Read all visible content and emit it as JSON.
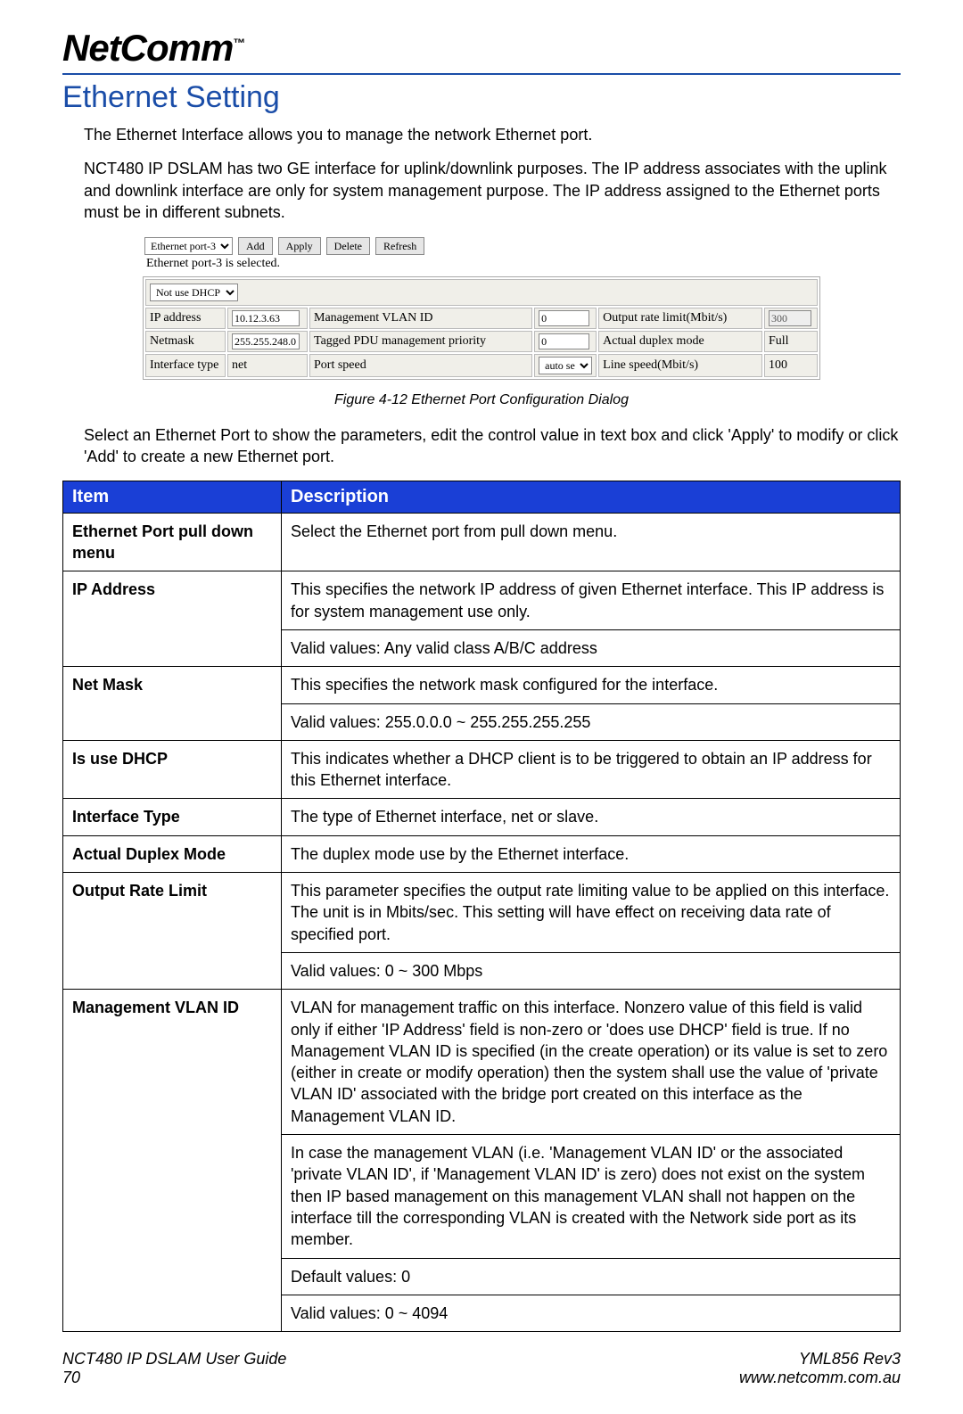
{
  "brand": {
    "name": "NetComm",
    "tm": "™"
  },
  "title": "Ethernet Setting",
  "paras": {
    "intro": "The Ethernet Interface allows you to manage the network Ethernet port.",
    "detail": "NCT480 IP DSLAM has two GE interface for uplink/downlink purposes. The IP address associates with the uplink and downlink interface are only for system management purpose. The IP address assigned to the Ethernet ports must be in different subnets.",
    "usage": "Select an Ethernet Port to show the parameters, edit the control value in text box and click 'Apply' to modify or click 'Add' to create a new Ethernet port."
  },
  "dialog": {
    "port_select": "Ethernet port-3",
    "buttons": {
      "add": "Add",
      "apply": "Apply",
      "delete": "Delete",
      "refresh": "Refresh"
    },
    "status": "Ethernet port-3 is selected.",
    "dhcp_select": "Not use DHCP",
    "fields": {
      "ip_label": "IP address",
      "ip_value": "10.12.3.63",
      "mgmt_vlan_label": "Management VLAN ID",
      "mgmt_vlan_value": "0",
      "out_rate_label": "Output rate limit(Mbit/s)",
      "out_rate_value": "300",
      "netmask_label": "Netmask",
      "netmask_value": "255.255.248.0",
      "tagged_label": "Tagged PDU management priority",
      "tagged_value": "0",
      "duplex_label": "Actual duplex mode",
      "duplex_value": "Full",
      "iftype_label": "Interface type",
      "iftype_value": "net",
      "portspeed_label": "Port speed",
      "portspeed_value": "auto select",
      "linespeed_label": "Line speed(Mbit/s)",
      "linespeed_value": "100"
    }
  },
  "figure_caption": "Figure 4-12 Ethernet Port Configuration Dialog",
  "table": {
    "head_item": "Item",
    "head_desc": "Description",
    "rows": [
      {
        "item": "Ethernet Port pull down menu",
        "descs": [
          "Select the Ethernet port from pull down menu."
        ]
      },
      {
        "item": "IP Address",
        "descs": [
          "This specifies the network IP address of given Ethernet interface. This IP address is for system management use only.",
          "Valid values: Any valid class A/B/C address"
        ]
      },
      {
        "item": "Net Mask",
        "descs": [
          "This specifies the network mask configured for the interface.",
          "Valid values: 255.0.0.0 ~ 255.255.255.255"
        ]
      },
      {
        "item": "Is use DHCP",
        "descs": [
          "This indicates whether a DHCP client is to be triggered to obtain an IP address for this Ethernet interface."
        ]
      },
      {
        "item": "Interface Type",
        "descs": [
          "The type of Ethernet interface, net or slave."
        ]
      },
      {
        "item": "Actual Duplex Mode",
        "descs": [
          "The duplex mode use by the Ethernet interface."
        ]
      },
      {
        "item": "Output Rate Limit",
        "descs": [
          "This parameter specifies the output rate limiting value to be applied on this interface. The unit is in Mbits/sec. This setting will have effect on receiving data rate of specified port.",
          "Valid values: 0 ~ 300 Mbps"
        ]
      },
      {
        "item": "Management VLAN ID",
        "descs": [
          "VLAN for management traffic on this interface. Nonzero value of this field is valid only if either 'IP Address' field is non-zero or 'does use DHCP' field is true. If no Management VLAN ID is specified (in the create operation) or its value is set to zero (either in create or modify operation) then the system shall use the value of 'private VLAN ID' associated with the bridge port created on this interface as the Management VLAN ID.",
          "In case the management VLAN (i.e. 'Management VLAN ID' or the associated 'private VLAN ID', if 'Management VLAN ID' is zero) does not exist on the system then IP based management on this management VLAN shall not happen on the interface till the corresponding VLAN is created with the Network side port as its member.",
          "Default values: 0",
          "Valid values: 0 ~ 4094"
        ]
      }
    ]
  },
  "footer": {
    "guide": "NCT480 IP DSLAM User Guide",
    "page": "70",
    "rev": "YML856 Rev3",
    "url": "www.netcomm.com.au"
  }
}
